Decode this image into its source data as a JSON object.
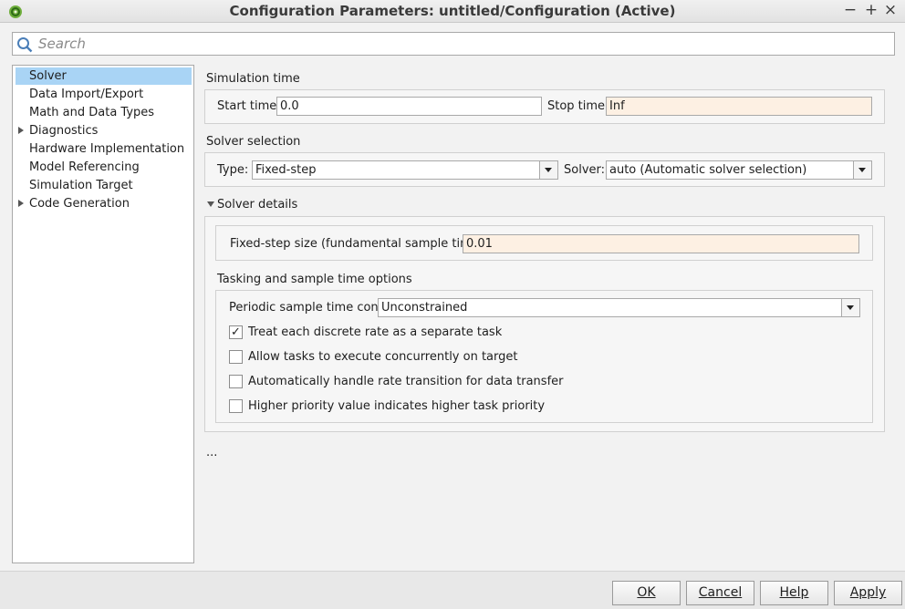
{
  "window": {
    "title": "Configuration Parameters: untitled/Configuration (Active)",
    "icon": "simulink-icon",
    "controls": {
      "minimize": "−",
      "maximize": "+",
      "close": "×"
    }
  },
  "search": {
    "placeholder": "Search",
    "value": ""
  },
  "sidebar": {
    "items": [
      {
        "label": "Solver",
        "selected": true,
        "expandable": false
      },
      {
        "label": "Data Import/Export",
        "selected": false,
        "expandable": false
      },
      {
        "label": "Math and Data Types",
        "selected": false,
        "expandable": false
      },
      {
        "label": "Diagnostics",
        "selected": false,
        "expandable": true
      },
      {
        "label": "Hardware Implementation",
        "selected": false,
        "expandable": false
      },
      {
        "label": "Model Referencing",
        "selected": false,
        "expandable": false
      },
      {
        "label": "Simulation Target",
        "selected": false,
        "expandable": false
      },
      {
        "label": "Code Generation",
        "selected": false,
        "expandable": true
      }
    ]
  },
  "simulation_time": {
    "title": "Simulation time",
    "start_label": "Start time:",
    "start_value": "0.0",
    "stop_label": "Stop time:",
    "stop_value": "Inf"
  },
  "solver_selection": {
    "title": "Solver selection",
    "type_label": "Type:",
    "type_value": "Fixed-step",
    "solver_label": "Solver:",
    "solver_value": "auto (Automatic solver selection)"
  },
  "solver_details": {
    "title": "Solver details",
    "fixed_step_label": "Fixed-step size (fundamental sample time):",
    "fixed_step_value": "0.01"
  },
  "tasking": {
    "title": "Tasking and sample time options",
    "periodic_label": "Periodic sample time constraint:",
    "periodic_value": "Unconstrained",
    "checkboxes": [
      {
        "label": "Treat each discrete rate as a separate task",
        "checked": true,
        "mark": "✓"
      },
      {
        "label": "Allow tasks to execute concurrently on target",
        "checked": false,
        "mark": ""
      },
      {
        "label": "Automatically handle rate transition for data transfer",
        "checked": false,
        "mark": ""
      },
      {
        "label": "Higher priority value indicates higher task priority",
        "checked": false,
        "mark": ""
      }
    ]
  },
  "more": "...",
  "footer": {
    "ok": "OK",
    "cancel": "Cancel",
    "help": "Help",
    "apply": "Apply"
  },
  "colors": {
    "selection": "#a9d4f5",
    "tinted_field": "#fdf0e3"
  }
}
